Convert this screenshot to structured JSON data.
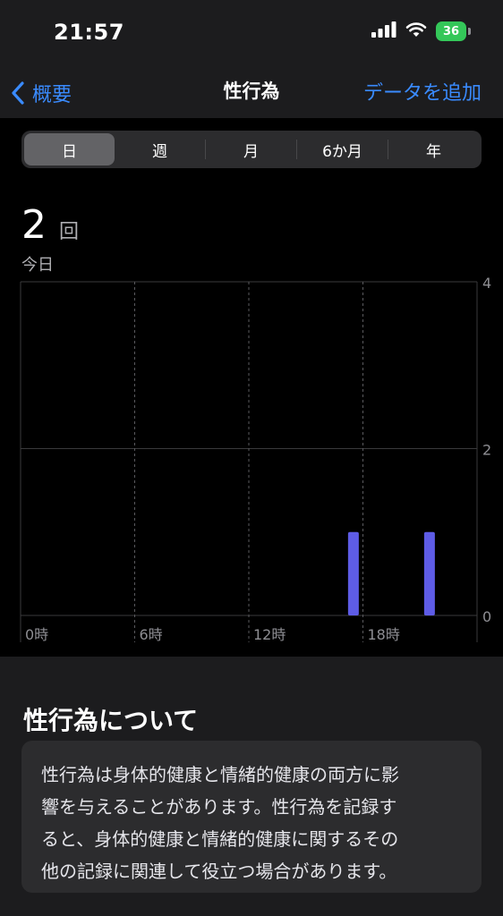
{
  "status_bar": {
    "time": "21:57",
    "battery": "36"
  },
  "nav": {
    "back_label": "概要",
    "title": "性行為",
    "add_label": "データを追加"
  },
  "segments": [
    "日",
    "週",
    "月",
    "6か月",
    "年"
  ],
  "active_segment": 0,
  "summary": {
    "value": "2",
    "unit": "回",
    "period": "今日"
  },
  "chart_data": {
    "type": "bar",
    "x_tick_labels": [
      "0時",
      "6時",
      "12時",
      "18時"
    ],
    "x_ticks": [
      0,
      6,
      12,
      18
    ],
    "xlim": [
      0,
      24
    ],
    "y_tick_labels": [
      "4",
      "2",
      "0"
    ],
    "ylim": [
      0,
      4
    ],
    "bars": [
      {
        "hour": 17,
        "value": 1
      },
      {
        "hour": 21,
        "value": 1
      }
    ],
    "bar_color": "#5e5ce6"
  },
  "about": {
    "title": "性行為について",
    "lines": [
      "性行為は身体的健康と情緒的健康の両方に影",
      "響を与えることがあります。性行為を記録す",
      "ると、身体的健康と情緒的健康に関するその",
      "他の記録に関連して役立つ場合があります。"
    ]
  },
  "colors": {
    "accent": "#3a8bff",
    "battery": "#34c759"
  }
}
